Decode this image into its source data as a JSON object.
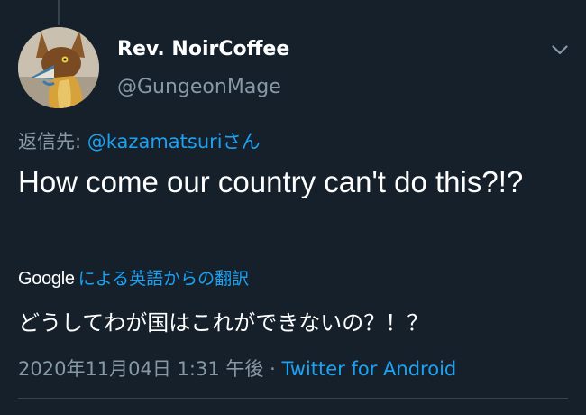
{
  "tweet": {
    "author": {
      "display_name": "Rev. NoirCoffee",
      "handle": "@GungeonMage",
      "avatar_icon": "fox-mascot-avatar"
    },
    "reply_to": {
      "prefix": "返信先: ",
      "mention": "@kazamatsuri",
      "suffix": "さん"
    },
    "text": "How come our country can't do this?!?",
    "translation": {
      "provider": "Google",
      "label": "による英語からの翻訳",
      "text": "どうしてわが国はこれができないの？！？"
    },
    "meta": {
      "timestamp": "2020年11月04日 1:31 午後",
      "separator": " · ",
      "source": "Twitter for Android"
    }
  },
  "colors": {
    "background": "#15202b",
    "primary_text": "#ffffff",
    "secondary_text": "#8899a6",
    "accent": "#1da1f2",
    "divider": "#38444d"
  },
  "icons": {
    "menu_caret": "chevron-down-icon"
  }
}
